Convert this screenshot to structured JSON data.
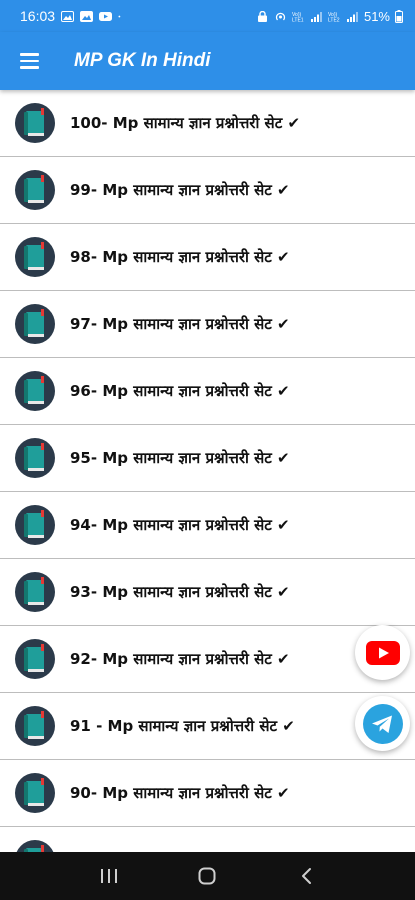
{
  "status_bar": {
    "time": "16:03",
    "battery": "51%"
  },
  "app_bar": {
    "title": "MP GK In Hindi"
  },
  "list": {
    "items": [
      {
        "label": "100- Mp सामान्य ज्ञान प्रश्नोत्तरी सेट ✔"
      },
      {
        "label": "99- Mp सामान्य ज्ञान प्रश्नोत्तरी सेट ✔"
      },
      {
        "label": "98- Mp सामान्य ज्ञान प्रश्नोत्तरी सेट ✔"
      },
      {
        "label": "97- Mp सामान्य ज्ञान प्रश्नोत्तरी सेट ✔"
      },
      {
        "label": "96- Mp सामान्य ज्ञान प्रश्नोत्तरी सेट ✔"
      },
      {
        "label": "95- Mp सामान्य ज्ञान प्रश्नोत्तरी सेट ✔"
      },
      {
        "label": "94- Mp सामान्य ज्ञान प्रश्नोत्तरी सेट ✔"
      },
      {
        "label": "93- Mp सामान्य ज्ञान प्रश्नोत्तरी सेट ✔"
      },
      {
        "label": "92- Mp सामान्य ज्ञान प्रश्नोत्तरी सेट ✔"
      },
      {
        "label": "91 - Mp सामान्य ज्ञान प्रश्नोत्तरी सेट ✔"
      },
      {
        "label": "90- Mp सामान्य ज्ञान प्रश्नोत्तरी सेट ✔"
      },
      {
        "label": ""
      }
    ]
  },
  "colors": {
    "primary": "#2e8fe8",
    "book_teal": "#1f9e9a",
    "youtube_red": "#ff0000",
    "telegram_blue": "#2aa3df"
  },
  "icons": {
    "menu": "hamburger-icon",
    "item": "book-icon",
    "youtube": "youtube-icon",
    "telegram": "telegram-icon",
    "nav_recents": "recents-icon",
    "nav_home": "home-icon",
    "nav_back": "back-icon"
  }
}
